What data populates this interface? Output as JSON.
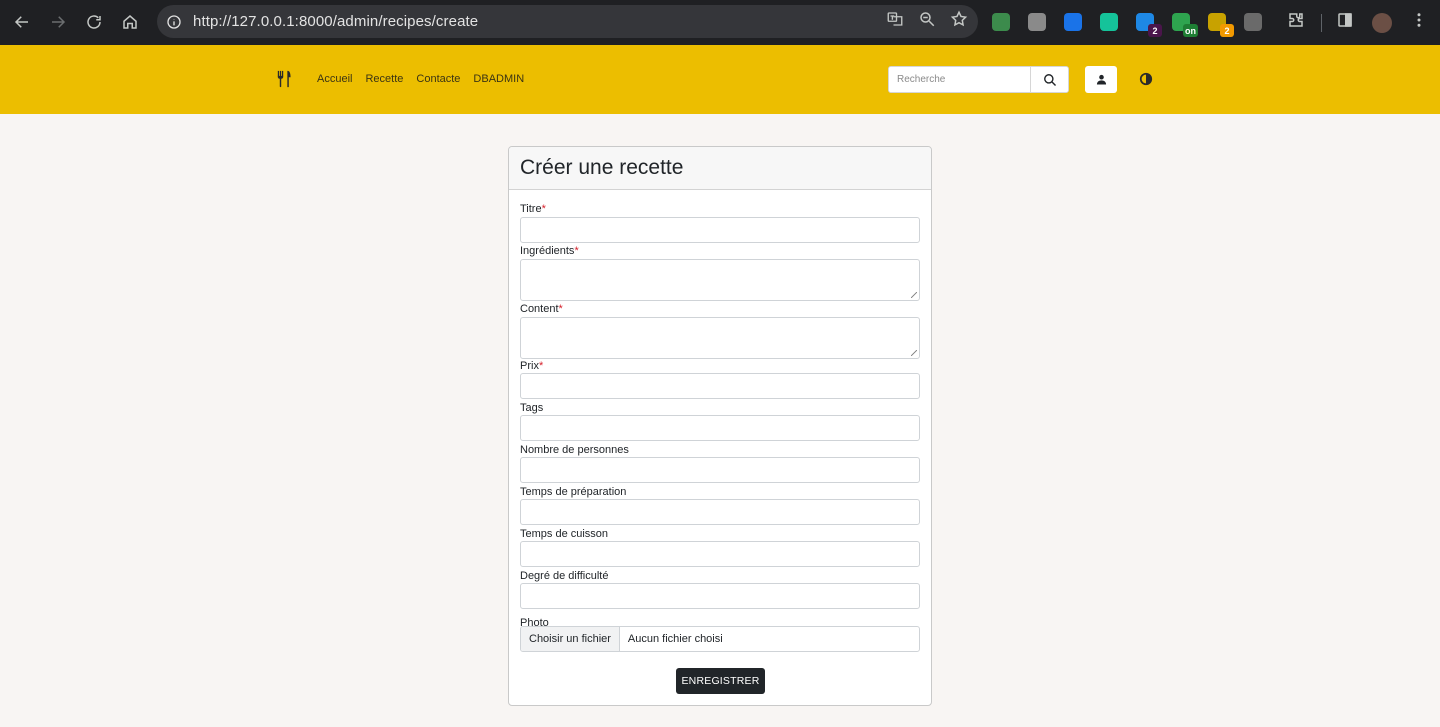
{
  "browser": {
    "url": "http://127.0.0.1:8000/admin/recipes/create",
    "extensions": [
      {
        "name": "mail-extension-icon",
        "color": "#3c8b4c",
        "badge": ""
      },
      {
        "name": "reader-extension-icon",
        "color": "#8a8a8a",
        "badge": ""
      },
      {
        "name": "target-extension-icon",
        "color": "#1a73e8",
        "badge": ""
      },
      {
        "name": "grammarly-icon",
        "color": "#15c39a",
        "badge": ""
      },
      {
        "name": "chat-extension-icon",
        "color": "#1e88e5",
        "badge": "2",
        "badge_color": "#4a154b"
      },
      {
        "name": "toggle-extension-icon",
        "color": "#2ea44f",
        "badge": "on",
        "badge_color": "#1e7e34"
      },
      {
        "name": "weather-extension-icon",
        "color": "#c8a200",
        "badge": "2",
        "badge_color": "#f29900"
      },
      {
        "name": "settings-extension-icon",
        "color": "#6a6a6a",
        "badge": ""
      }
    ]
  },
  "nav": {
    "links": [
      "Accueil",
      "Recette",
      "Contacte",
      "DBADMIN"
    ],
    "search_placeholder": "Recherche",
    "bg_color": "#ecbe00"
  },
  "form": {
    "title": "Créer une recette",
    "fields": [
      {
        "label": "Titre",
        "required": true,
        "type": "text"
      },
      {
        "label": "Ingrédients",
        "required": true,
        "type": "textarea"
      },
      {
        "label": "Content",
        "required": true,
        "type": "textarea"
      },
      {
        "label": "Prix",
        "required": true,
        "type": "text"
      },
      {
        "label": "Tags",
        "required": false,
        "type": "text"
      },
      {
        "label": "Nombre de personnes",
        "required": false,
        "type": "text"
      },
      {
        "label": "Temps de préparation",
        "required": false,
        "type": "text"
      },
      {
        "label": "Temps de cuisson",
        "required": false,
        "type": "text"
      },
      {
        "label": "Degré de difficulté",
        "required": false,
        "type": "text"
      }
    ],
    "photo": {
      "label": "Photo",
      "button": "Choisir un fichier",
      "status": "Aucun fichier choisi"
    },
    "submit": "ENREGISTRER",
    "required_mark": "*"
  }
}
